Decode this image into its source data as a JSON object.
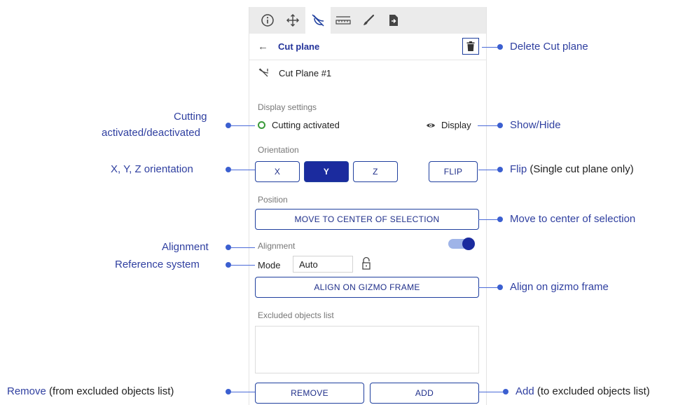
{
  "panel": {
    "header_title": "Cut plane",
    "plane_name": "Cut Plane #1",
    "display_settings_label": "Display settings",
    "cutting_status": "Cutting activated",
    "display_label": "Display",
    "orientation_label": "Orientation",
    "orientation_buttons": [
      "X",
      "Y",
      "Z"
    ],
    "orientation_selected": "Y",
    "flip_label": "FLIP",
    "position_label": "Position",
    "move_center_label": "MOVE TO CENTER OF SELECTION",
    "alignment_label": "Alignment",
    "alignment_enabled": true,
    "mode_label": "Mode",
    "mode_value": "Auto",
    "align_gizmo_label": "ALIGN ON GIZMO FRAME",
    "excluded_label": "Excluded objects list",
    "remove_label": "REMOVE",
    "add_label": "ADD"
  },
  "toolbar_icons": [
    "info-icon",
    "move-icon",
    "cut-plane-icon",
    "ruler-icon",
    "brush-icon",
    "export-icon"
  ],
  "annotations": {
    "delete": "Delete Cut plane",
    "cutting_line1": "Cutting",
    "cutting_line2": "activated/deactivated",
    "show_hide": "Show/Hide",
    "xyz": "X, Y, Z orientation",
    "flip_main": "Flip",
    "flip_note": "(Single cut plane only)",
    "move_center": "Move to center of selection",
    "alignment": "Alignment",
    "reference": "Reference system",
    "align_gizmo": "Align on gizmo frame",
    "remove_main": "Remove",
    "remove_note": "(from excluded objects list)",
    "add_main": "Add",
    "add_note": "(to excluded objects list)"
  },
  "colors": {
    "accent": "#1f3f9e",
    "annotation": "#2f3fa0",
    "status_green": "#3a9a3a"
  }
}
